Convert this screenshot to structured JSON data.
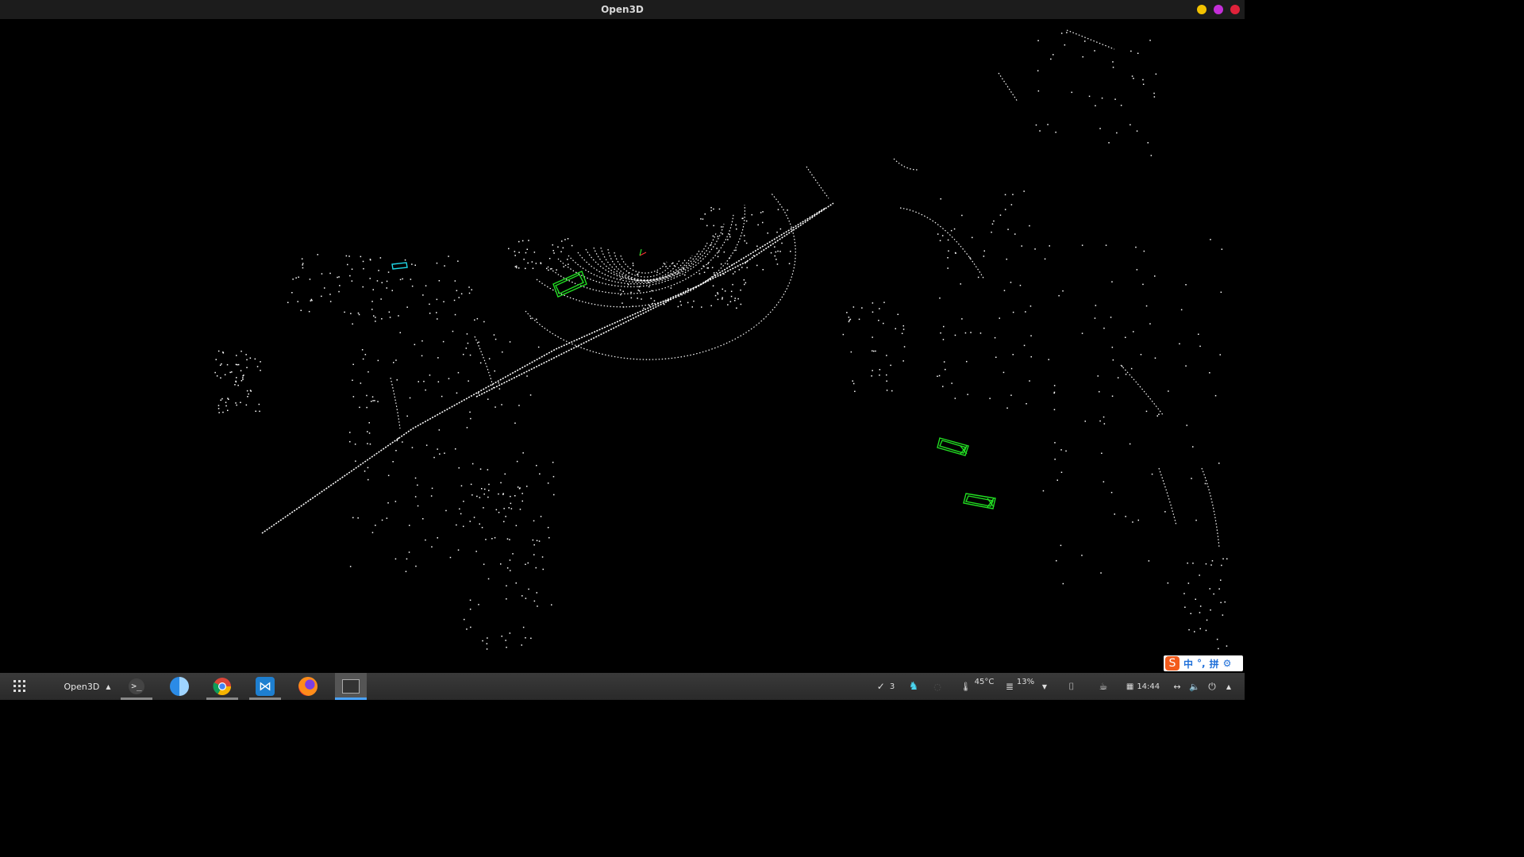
{
  "window": {
    "title": "Open3D"
  },
  "taskbar": {
    "active_app_label": "Open3D",
    "apps": [
      {
        "name": "terminal-icon"
      },
      {
        "name": "finder-icon"
      },
      {
        "name": "chrome-icon"
      },
      {
        "name": "vscode-icon"
      },
      {
        "name": "firefox-icon"
      },
      {
        "name": "window-icon"
      }
    ],
    "tray": {
      "tasks_count": "3",
      "temperature": "45°C",
      "disk_usage": "13%",
      "clock": "14:44"
    }
  },
  "ime": {
    "lang": "中",
    "punct": "°,",
    "mode": "拼"
  },
  "colors": {
    "close": "#e0223a",
    "maximize": "#c42fd8",
    "minimize": "#f2c200",
    "box_green": "#22dd22",
    "box_cyan": "#20d8e8",
    "points": "#ffffff"
  }
}
